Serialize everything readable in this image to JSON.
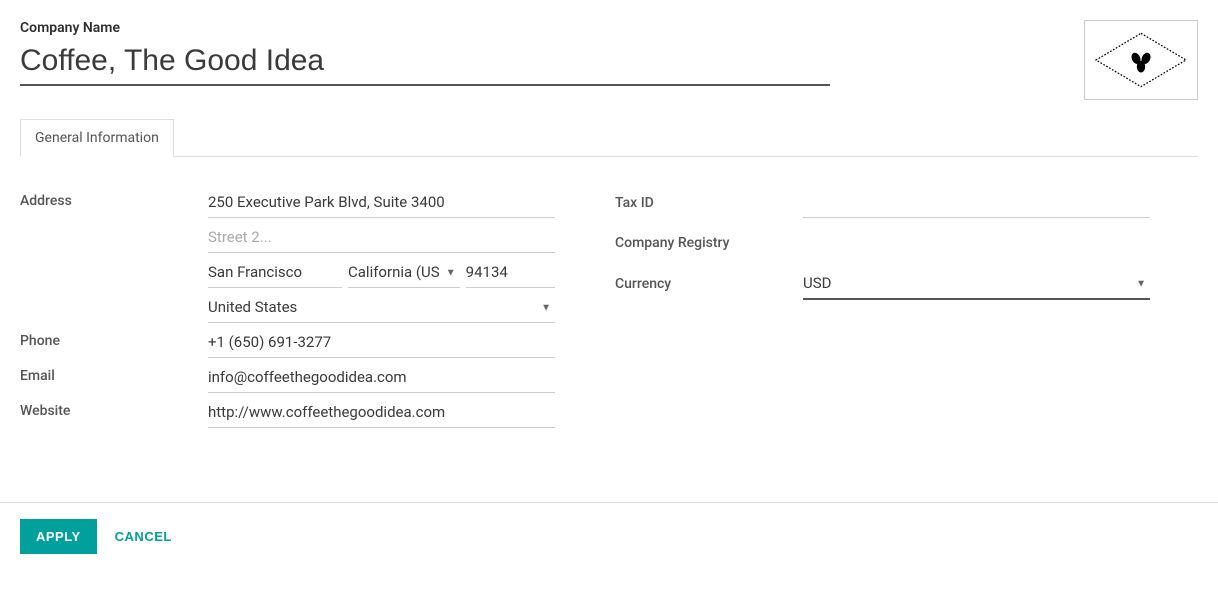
{
  "header": {
    "company_name_label": "Company Name",
    "company_name_value": "Coffee, The Good Idea",
    "logo_name": "coffee-beans-diamond-logo"
  },
  "tabs": {
    "general_information": "General Information"
  },
  "left": {
    "address_label": "Address",
    "street1_value": "250 Executive Park Blvd, Suite 3400",
    "street2_placeholder": "Street 2...",
    "street2_value": "",
    "city_value": "San Francisco",
    "state_value": "California (US)",
    "zip_value": "94134",
    "country_value": "United States",
    "phone_label": "Phone",
    "phone_value": "+1 (650) 691-3277",
    "email_label": "Email",
    "email_value": "info@coffeethegoodidea.com",
    "website_label": "Website",
    "website_value": "http://www.coffeethegoodidea.com"
  },
  "right": {
    "tax_id_label": "Tax ID",
    "tax_id_value": "",
    "company_registry_label": "Company Registry",
    "company_registry_value": "",
    "currency_label": "Currency",
    "currency_value": "USD"
  },
  "footer": {
    "apply_label": "APPLY",
    "cancel_label": "CANCEL"
  }
}
